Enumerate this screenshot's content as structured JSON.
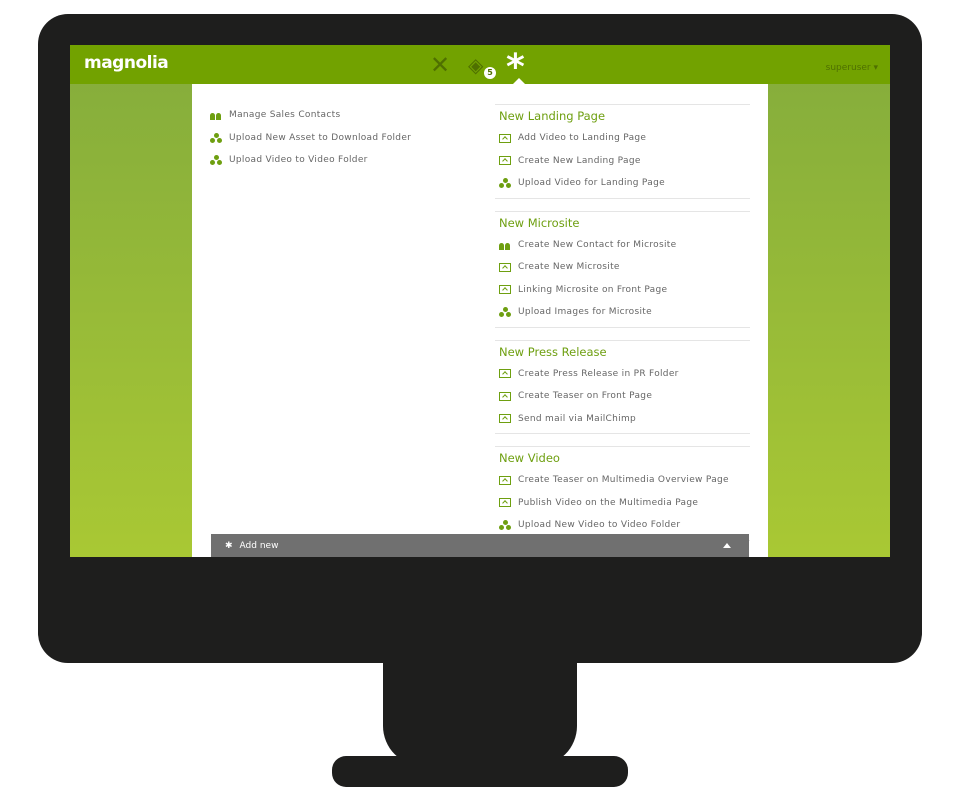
{
  "header": {
    "logo": "magnolia",
    "user": "superuser ▾",
    "pulse_badge": "5",
    "icons": [
      "apps-icon",
      "pulse-icon",
      "favorites-icon"
    ],
    "accent": "#72a200"
  },
  "favorites": [
    {
      "label": "Manage Sales Contacts",
      "icon": "ppl"
    },
    {
      "label": "Upload New Asset to Download Folder",
      "icon": "dam"
    },
    {
      "label": "Upload Video to Video Folder",
      "icon": "dam"
    }
  ],
  "groups": [
    {
      "title": "New Landing Page",
      "items": [
        {
          "label": "Add Video to Landing Page",
          "icon": "page"
        },
        {
          "label": "Create New Landing Page",
          "icon": "page"
        },
        {
          "label": "Upload Video for Landing Page",
          "icon": "dam"
        }
      ]
    },
    {
      "title": "New Microsite",
      "items": [
        {
          "label": "Create New Contact for Microsite",
          "icon": "ppl"
        },
        {
          "label": "Create New Microsite",
          "icon": "page"
        },
        {
          "label": "Linking Microsite on Front Page",
          "icon": "page"
        },
        {
          "label": "Upload Images for Microsite",
          "icon": "dam"
        }
      ]
    },
    {
      "title": "New Press Release",
      "items": [
        {
          "label": "Create Press Release in PR Folder",
          "icon": "page"
        },
        {
          "label": "Create Teaser on Front Page",
          "icon": "page"
        },
        {
          "label": "Send mail via MailChimp",
          "icon": "page"
        }
      ]
    },
    {
      "title": "New Video",
      "items": [
        {
          "label": "Create Teaser on Multimedia Overview Page",
          "icon": "page"
        },
        {
          "label": "Publish Video on the Multimedia Page",
          "icon": "page"
        },
        {
          "label": "Upload New Video to Video Folder",
          "icon": "dam"
        }
      ]
    }
  ],
  "add_bar": {
    "label": "Add new"
  }
}
